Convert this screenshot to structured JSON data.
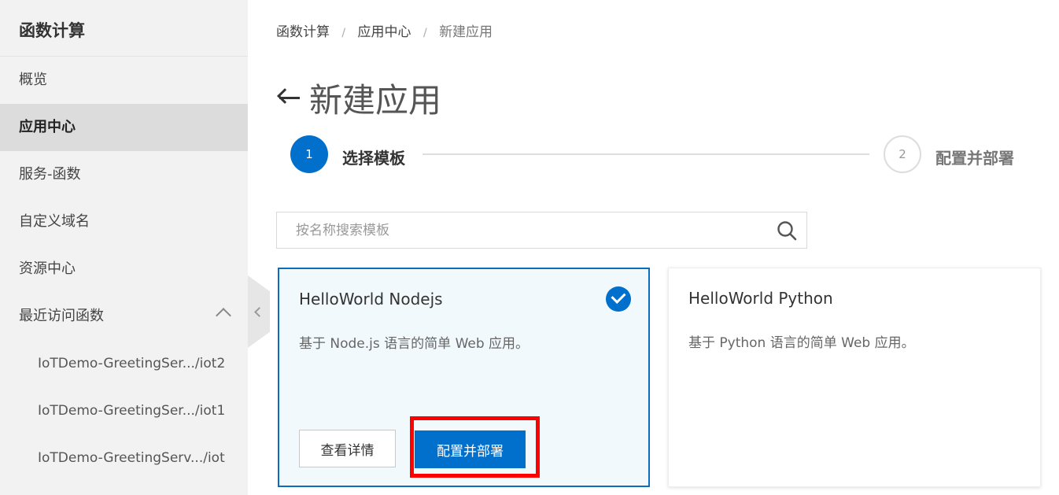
{
  "sidebar": {
    "title": "函数计算",
    "items": [
      {
        "label": "概览"
      },
      {
        "label": "应用中心"
      },
      {
        "label": "服务-函数"
      },
      {
        "label": "自定义域名"
      },
      {
        "label": "资源中心"
      },
      {
        "label": "最近访问函数"
      }
    ],
    "recent": [
      {
        "label": "IoTDemo-GreetingSer.../iot2"
      },
      {
        "label": "IoTDemo-GreetingSer.../iot1"
      },
      {
        "label": "IoTDemo-GreetingServ.../iot"
      }
    ]
  },
  "breadcrumb": [
    "函数计算",
    "应用中心",
    "新建应用"
  ],
  "breadcrumb_separator": "/",
  "page": {
    "title": "新建应用"
  },
  "steps": [
    {
      "number": "1",
      "label": "选择模板"
    },
    {
      "number": "2",
      "label": "配置并部署"
    }
  ],
  "search": {
    "placeholder": "按名称搜索模板",
    "value": ""
  },
  "templates": [
    {
      "title": "HelloWorld Nodejs",
      "desc": "基于 Node.js 语言的简单 Web 应用。",
      "detail_label": "查看详情",
      "deploy_label": "配置并部署"
    },
    {
      "title": "HelloWorld Python",
      "desc": "基于 Python 语言的简单 Web 应用。"
    }
  ],
  "colors": {
    "accent": "#0070cc",
    "highlight": "#ff0000",
    "top_bar": "#ff6a00"
  }
}
